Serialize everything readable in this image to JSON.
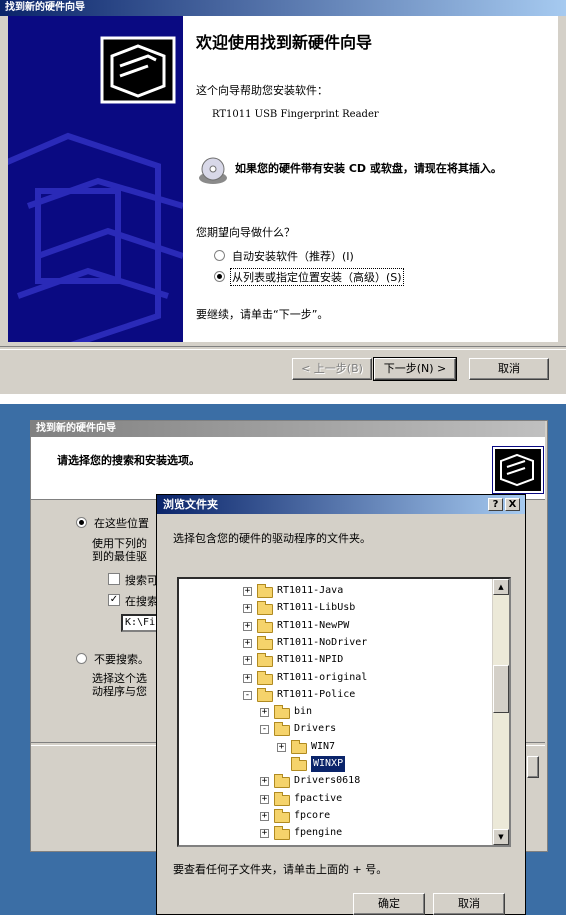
{
  "wizard1": {
    "title": "找到新的硬件向导",
    "heading": "欢迎使用找到新硬件向导",
    "intro": "这个向导帮助您安装软件：",
    "device": "RT1011 USB Fingerprint Reader",
    "cd_hint": "如果您的硬件带有安装 CD 或软盘，请现在将其插入。",
    "question": "您期望向导做什么？",
    "option_auto": "自动安装软件（推荐）(I)",
    "option_list": "从列表或指定位置安装（高级）(S)",
    "continue_text": "要继续，请单击“下一步”。",
    "back_button": "< 上一步(B)",
    "next_button": "下一步(N) >",
    "cancel_button": "取消"
  },
  "wizard2": {
    "title": "找到新的硬件向导",
    "heading": "请选择您的搜索和安装选项。",
    "opt_search": "在这些位置",
    "search_desc_1": "使用下列的",
    "search_desc_2": "到的最佳驱",
    "chk_removable": "搜索可",
    "chk_include": "在搜索",
    "path_value": "K:\\Fi",
    "opt_nosearch": "不要搜索。",
    "nosearch_desc_1": "选择这个选",
    "nosearch_desc_2": "动程序与您"
  },
  "browse_dialog": {
    "title": "浏览文件夹",
    "help_button": "?",
    "close_button": "X",
    "prompt": "选择包含您的硬件的驱动程序的文件夹。",
    "tree": [
      {
        "label": "RT1011-Java",
        "toggle": "+"
      },
      {
        "label": "RT1011-LibUsb",
        "toggle": "+"
      },
      {
        "label": "RT1011-NewPW",
        "toggle": "+"
      },
      {
        "label": "RT1011-NoDriver",
        "toggle": "+"
      },
      {
        "label": "RT1011-NPID",
        "toggle": "+"
      },
      {
        "label": "RT1011-original",
        "toggle": "+"
      },
      {
        "label": "RT1011-Police",
        "toggle": "-"
      },
      {
        "label": "bin",
        "toggle": "+"
      },
      {
        "label": "Drivers",
        "toggle": "-"
      },
      {
        "label": "WIN7",
        "toggle": "+"
      },
      {
        "label": "WINXP",
        "toggle": ""
      },
      {
        "label": "Drivers0618",
        "toggle": "+"
      },
      {
        "label": "fpactive",
        "toggle": "+"
      },
      {
        "label": "fpcore",
        "toggle": "+"
      },
      {
        "label": "fpengine",
        "toggle": "+"
      }
    ],
    "hint": "要查看任何子文件夹，请单击上面的 + 号。",
    "ok_button": "确定",
    "cancel_button": "取消"
  },
  "colors": {
    "titlebar_active": "#0a246a",
    "titlebar_inactive": "#808080",
    "desktop": "#3b6ea5",
    "side_panel": "#0a0a82",
    "selection": "#0a246a"
  }
}
